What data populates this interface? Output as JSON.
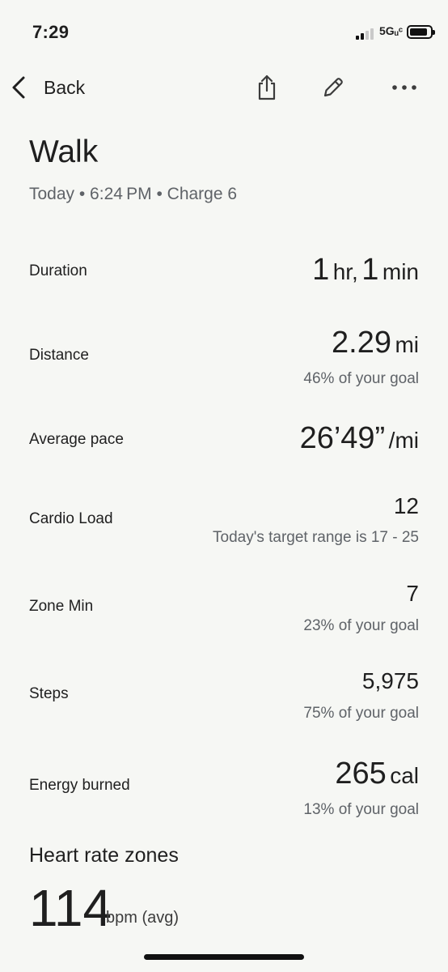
{
  "status_bar": {
    "time": "7:29",
    "network": "5Gᵤᶜ"
  },
  "nav": {
    "back_label": "Back"
  },
  "activity": {
    "title": "Walk",
    "subtitle": "Today • 6:24 PM • Charge 6"
  },
  "stats": {
    "duration": {
      "label": "Duration",
      "hr_num": "1",
      "hr_unit": "hr,",
      "min_num": "1",
      "min_unit": "min"
    },
    "distance": {
      "label": "Distance",
      "value": "2.29",
      "unit": "mi",
      "sub": "46% of your goal"
    },
    "pace": {
      "label": "Average pace",
      "value": "26’49”",
      "unit": "/mi"
    },
    "cardio_load": {
      "label": "Cardio Load",
      "value": "12",
      "sub": "Today's target range is 17 - 25"
    },
    "zone_min": {
      "label": "Zone Min",
      "value": "7",
      "sub": "23% of your goal"
    },
    "steps": {
      "label": "Steps",
      "value": "5,975",
      "sub": "75% of your goal"
    },
    "energy": {
      "label": "Energy burned",
      "value": "265",
      "unit": "cal",
      "sub": "13% of your goal"
    }
  },
  "heart_rate": {
    "title": "Heart rate zones",
    "value": "114",
    "unit": "bpm (avg)"
  },
  "icons": [
    "chevron-left-icon",
    "share-icon",
    "edit-pencil-icon",
    "more-horizontal-icon",
    "signal-icon",
    "battery-icon"
  ]
}
